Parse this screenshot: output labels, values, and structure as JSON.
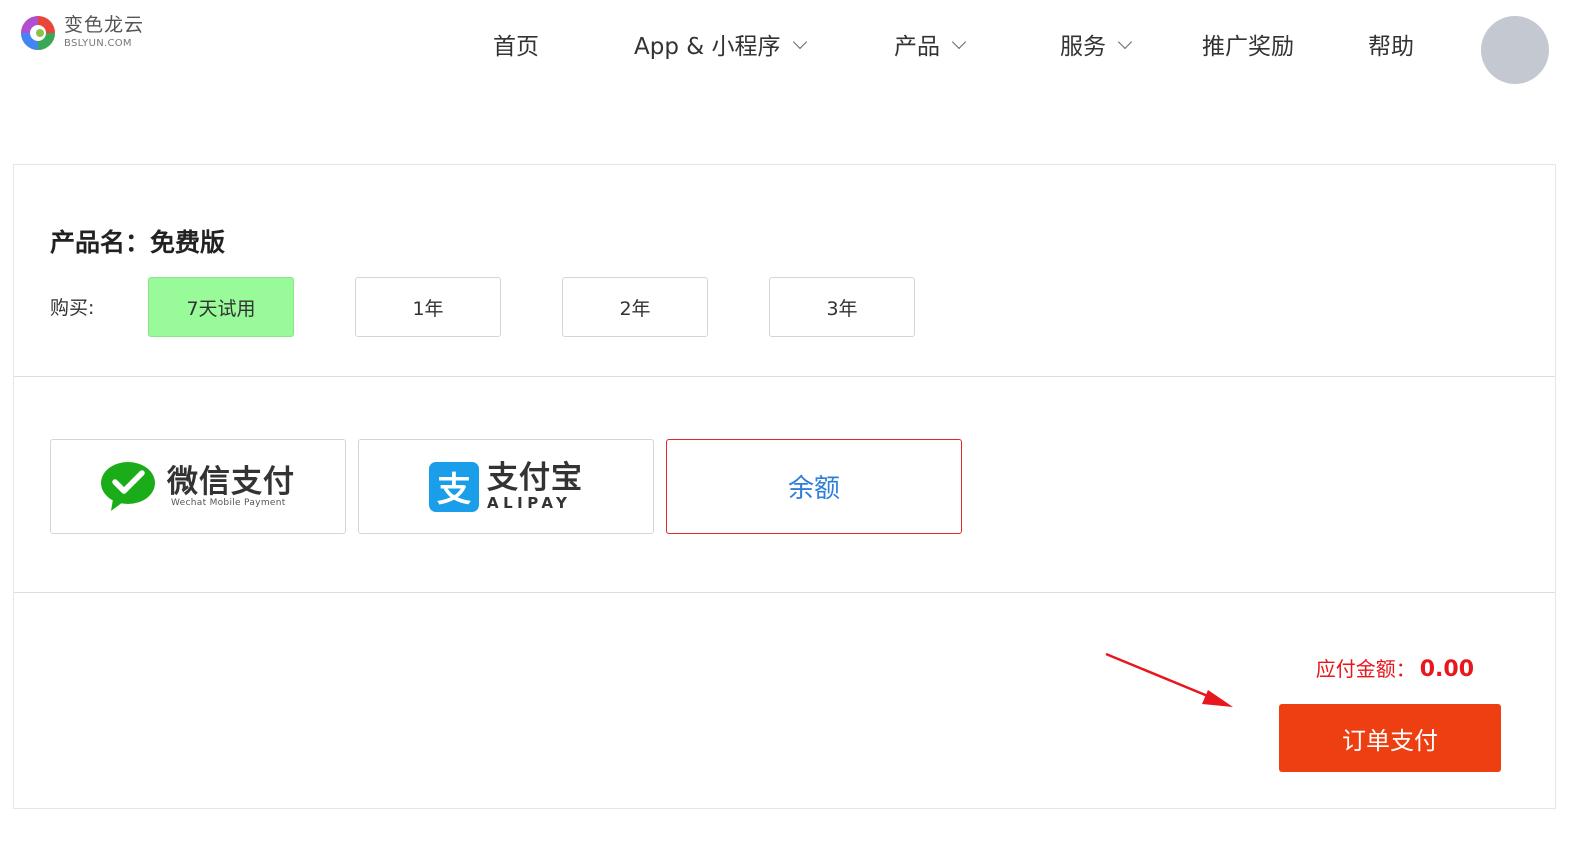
{
  "brand": {
    "name": "变色龙云",
    "domain": "BSLYUN.COM"
  },
  "nav": {
    "items": [
      {
        "label": "首页"
      },
      {
        "label": "App & 小程序"
      },
      {
        "label": "产品"
      },
      {
        "label": "服务"
      },
      {
        "label": "推广奖励"
      },
      {
        "label": "帮助"
      }
    ]
  },
  "product": {
    "title": "产品名：免费版",
    "buy_label": "购买:",
    "durations": [
      "7天试用",
      "1年",
      "2年",
      "3年"
    ],
    "selected_duration": "7天试用"
  },
  "payment": {
    "wechat": {
      "label": "微信支付",
      "sublabel": "Wechat Mobile Payment"
    },
    "alipay": {
      "icon_char": "支",
      "label": "支付宝",
      "sublabel": "ALIPAY"
    },
    "balance": {
      "label": "余额"
    },
    "selected": "余额"
  },
  "summary": {
    "amount_label": "应付金额：",
    "amount_value": "0.00",
    "submit_label": "订单支付"
  },
  "colors": {
    "selected_option_bg": "#98fa98",
    "selected_payment_border": "#e3262e",
    "balance_text": "#2f7fd8",
    "amount_text": "#e8161d",
    "submit_bg": "#ee3f12",
    "wechat_green": "#1aad19",
    "alipay_blue": "#1a9ee9",
    "annotation_arrow": "#e8161d"
  }
}
